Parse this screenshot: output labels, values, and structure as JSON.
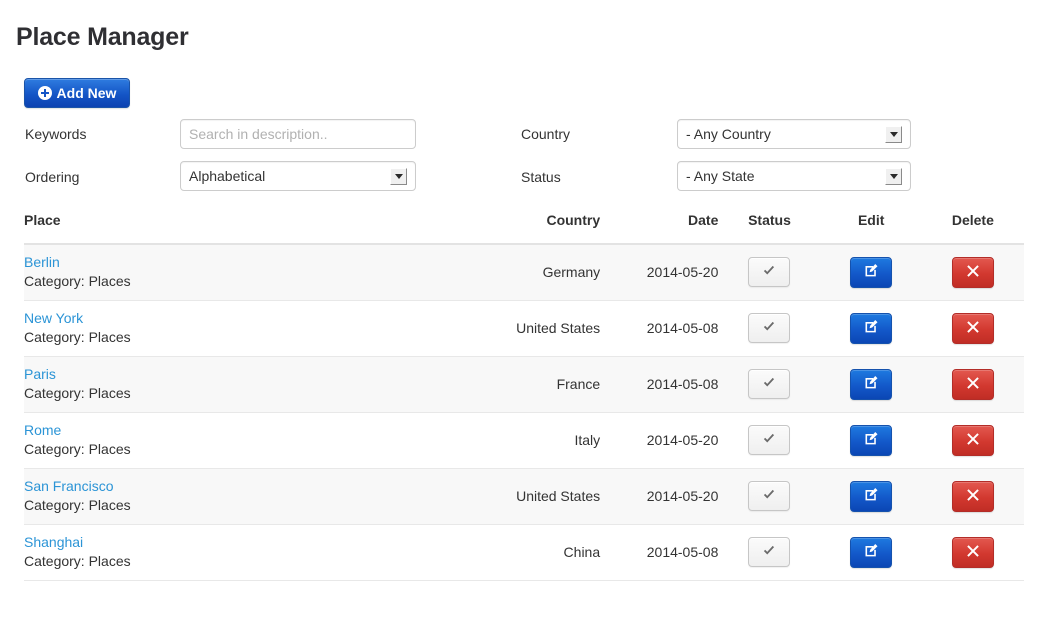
{
  "page": {
    "title": "Place Manager"
  },
  "toolbar": {
    "add_new_label": "Add New",
    "add_new_icon": "plus-circle-icon",
    "accent_blue": "#1455c6"
  },
  "filters": {
    "keywords": {
      "label": "Keywords",
      "value": "",
      "placeholder": "Search in description.."
    },
    "ordering": {
      "label": "Ordering",
      "selected": "Alphabetical"
    },
    "country": {
      "label": "Country",
      "selected": "- Any Country"
    },
    "status": {
      "label": "Status",
      "selected": "- Any State"
    }
  },
  "table": {
    "columns": {
      "place": "Place",
      "country": "Country",
      "date": "Date",
      "status": "Status",
      "edit": "Edit",
      "delete": "Delete"
    },
    "rows": [
      {
        "place": "Berlin",
        "category": "Category: Places",
        "country": "Germany",
        "date": "2014-05-20",
        "status_icon": "check-icon",
        "edit_icon": "pencil-square-icon",
        "delete_icon": "x-icon"
      },
      {
        "place": "New York",
        "category": "Category: Places",
        "country": "United States",
        "date": "2014-05-08",
        "status_icon": "check-icon",
        "edit_icon": "pencil-square-icon",
        "delete_icon": "x-icon"
      },
      {
        "place": "Paris",
        "category": "Category: Places",
        "country": "France",
        "date": "2014-05-08",
        "status_icon": "check-icon",
        "edit_icon": "pencil-square-icon",
        "delete_icon": "x-icon"
      },
      {
        "place": "Rome",
        "category": "Category: Places",
        "country": "Italy",
        "date": "2014-05-20",
        "status_icon": "check-icon",
        "edit_icon": "pencil-square-icon",
        "delete_icon": "x-icon"
      },
      {
        "place": "San Francisco",
        "category": "Category: Places",
        "country": "United States",
        "date": "2014-05-20",
        "status_icon": "check-icon",
        "edit_icon": "pencil-square-icon",
        "delete_icon": "x-icon"
      },
      {
        "place": "Shanghai",
        "category": "Category: Places",
        "country": "China",
        "date": "2014-05-08",
        "status_icon": "check-icon",
        "edit_icon": "pencil-square-icon",
        "delete_icon": "x-icon"
      }
    ]
  },
  "colors": {
    "link": "#2b94d6",
    "row_stripe": "#f8f8f8",
    "edit_blue": "#1358c9",
    "delete_red": "#d2382f"
  }
}
